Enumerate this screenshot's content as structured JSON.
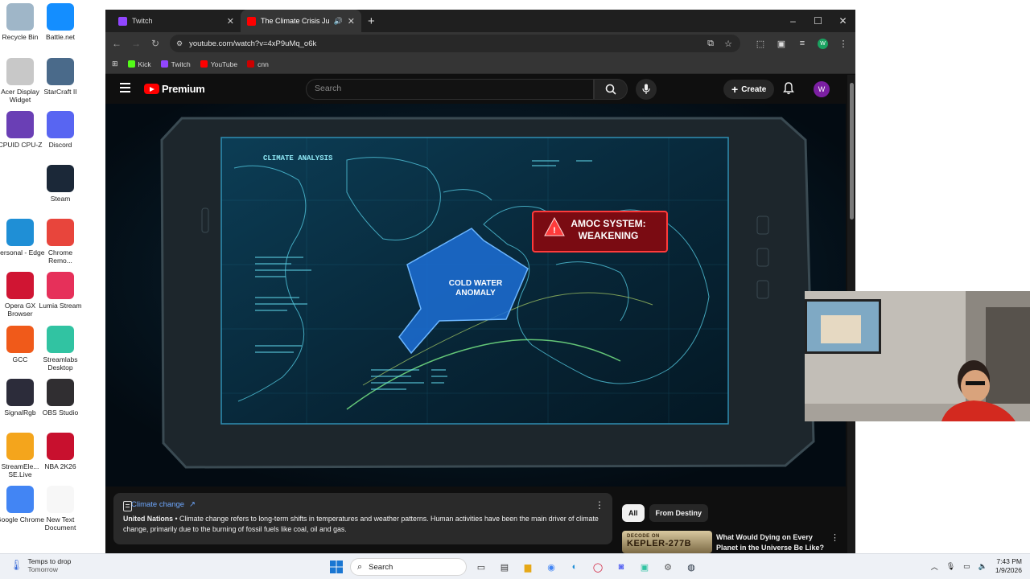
{
  "desktop": {
    "icons": [
      {
        "label": "Recycle Bin",
        "color": "#9fb6c8"
      },
      {
        "label": "Battle.net",
        "color": "#148eff"
      },
      {
        "label": "Acer Display Widget",
        "color": "#c8c8c8"
      },
      {
        "label": "StarCraft II",
        "color": "#4a6a8a"
      },
      {
        "label": "CPUID CPU-Z",
        "color": "#6a3fb5"
      },
      {
        "label": "Discord",
        "color": "#5865f2"
      },
      {
        "label": "Steam",
        "color": "#1b2838"
      },
      {
        "label": "Personal - Edge",
        "color": "#1f8fd6"
      },
      {
        "label": "Chrome Remo...",
        "color": "#e8453c"
      },
      {
        "label": "Opera GX Browser",
        "color": "#d01533"
      },
      {
        "label": "Lumia Stream",
        "color": "#e6305a"
      },
      {
        "label": "GCC",
        "color": "#f05a1a"
      },
      {
        "label": "Streamlabs Desktop",
        "color": "#31c3a2"
      },
      {
        "label": "SignalRgb",
        "color": "#2c2c3a"
      },
      {
        "label": "OBS Studio",
        "color": "#302e31"
      },
      {
        "label": "StreamEle... SE.Live",
        "color": "#f4a51c"
      },
      {
        "label": "NBA 2K26",
        "color": "#c8102e"
      },
      {
        "label": "Google Chrome",
        "color": "#4285f4"
      },
      {
        "label": "New Text Document",
        "color": "#f7f7f7"
      }
    ]
  },
  "browser": {
    "tabs": [
      {
        "title": "Twitch",
        "favicon_color": "#9146ff",
        "active": false
      },
      {
        "title": "The Climate Crisis Just Hit a",
        "favicon_color": "#ff0000",
        "active": true
      }
    ],
    "url": "youtube.com/watch?v=4xP9uMq_o6k",
    "bookmarks": [
      {
        "label": "Kick",
        "color": "#53fc18"
      },
      {
        "label": "Twitch",
        "color": "#9146ff"
      },
      {
        "label": "YouTube",
        "color": "#ff0000"
      },
      {
        "label": "cnn",
        "color": "#cc0000"
      }
    ],
    "profile_initial": "W"
  },
  "youtube": {
    "logo_text": "Premium",
    "search_placeholder": "Search",
    "create_label": "Create",
    "avatar_initial": "W",
    "video": {
      "panel_title": "CLIMATE ANALYSIS",
      "alert_line1": "AMOC SYSTEM:",
      "alert_line2": "WEAKENING",
      "anomaly_line1": "COLD WATER",
      "anomaly_line2": "ANOMALY"
    },
    "info_card": {
      "topic": "Climate change",
      "source": "United Nations",
      "text": " • Climate change refers to long-term shifts in temperatures and weather patterns. Human activities have been the main driver of climate change, primarily due to the burning of fossil fuels like coal, oil and gas."
    },
    "chips": [
      "All",
      "From Destiny"
    ],
    "recommended": {
      "thumb_line1": "DECODE ON",
      "thumb_line2": "KEPLER-277B",
      "title": "What Would Dying on Every Planet in the Universe Be Like?"
    }
  },
  "taskbar": {
    "weather_line1": "Temps to drop",
    "weather_line2": "Tomorrow",
    "search_label": "Search",
    "time": "7:43 PM",
    "date": "1/9/2026"
  }
}
